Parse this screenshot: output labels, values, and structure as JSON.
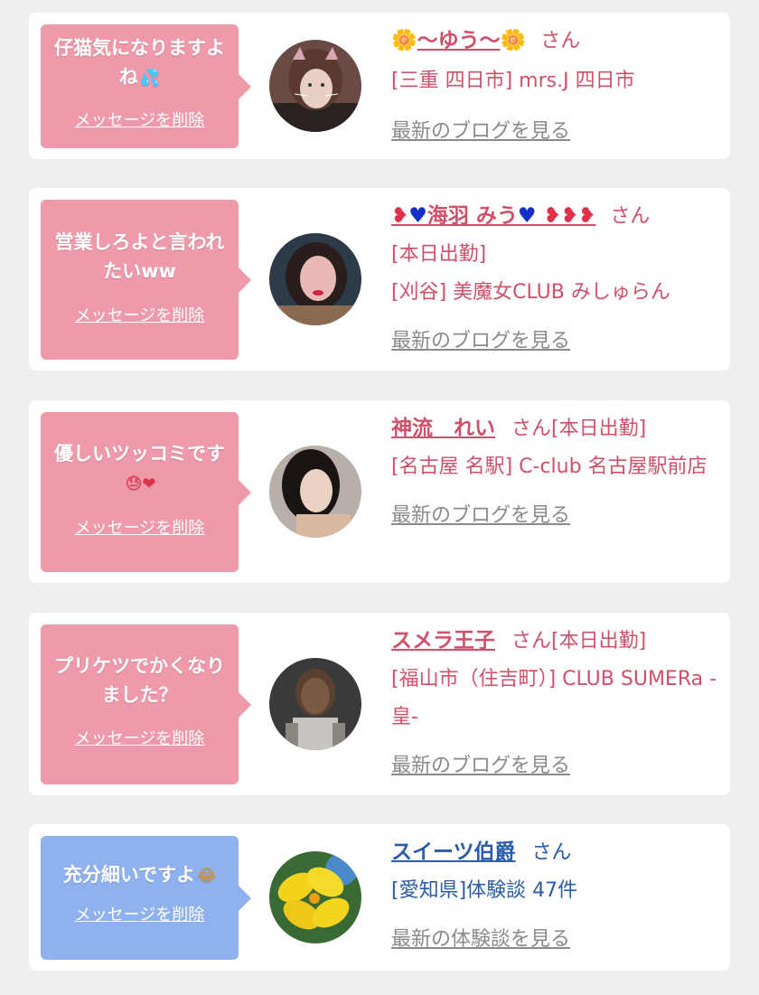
{
  "colors": {
    "card_bg": "#ffffff",
    "page_bg": "#eeeeee",
    "bubble_pink": "#ef9aab",
    "bubble_blue": "#8fb1ee",
    "text_pink": "#d0506a",
    "text_blue": "#2a5caa",
    "link_gray": "#8a8a8a"
  },
  "delete_label": "メッセージを削除",
  "san_label": "さん",
  "cards": [
    {
      "message": "仔猫気になりますよね",
      "message_emoji": "💦",
      "name": "〜ゆう〜",
      "name_deco": "🌼",
      "details": [
        "[三重 四日市] mrs.J 四日市"
      ],
      "blog_label": "最新のブログを見る",
      "avatar": "woman-cat-filter"
    },
    {
      "message": "営業しろよと言われたいww",
      "message_emoji": "",
      "name": "海羽 みう",
      "name_prefix": "❥",
      "name_heart": "♥",
      "name_suffix": "❥❥❥",
      "details": [
        "[本日出勤]",
        "[刈谷] 美魔女CLUB みしゅらん"
      ],
      "blog_label": "最新のブログを見る",
      "avatar": "woman-red-lips"
    },
    {
      "message": "優しいツッコミです",
      "message_emoji": "😓❤",
      "name": "神流　れい",
      "san_suffix": "[本日出勤]",
      "details": [
        "[名古屋 名駅] C-club 名古屋駅前店"
      ],
      "blog_label": "最新のブログを見る",
      "avatar": "woman-dark-hair"
    },
    {
      "message": "プリケツでかくなりました？",
      "message_emoji": "",
      "name": "スメラ王子",
      "san_suffix": "[本日出勤]",
      "details": [
        "[福山市（住吉町）] CLUB SUMERa -皇-"
      ],
      "blog_label": "最新のブログを見る",
      "avatar": "man-costume"
    },
    {
      "message": "充分細いですよ",
      "message_emoji": "😂",
      "name": "スイーツ伯爵",
      "details": [
        "[愛知県]体験談 47件"
      ],
      "blog_label": "最新の体験談を見る",
      "avatar": "yellow-hibiscus"
    }
  ]
}
